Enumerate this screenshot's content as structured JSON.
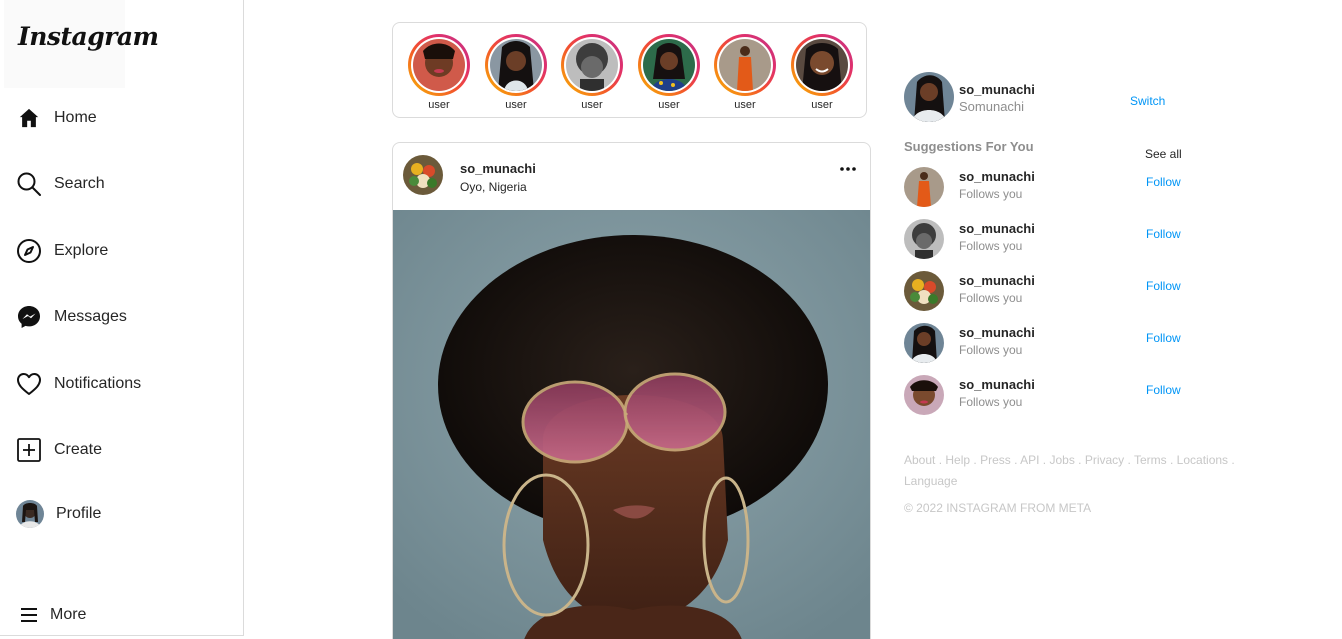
{
  "app": {
    "logo_text": "Instagram"
  },
  "nav": {
    "home": "Home",
    "search": "Search",
    "explore": "Explore",
    "messages": "Messages",
    "notifications": "Notifications",
    "create": "Create",
    "profile": "Profile",
    "more": "More"
  },
  "stories": [
    {
      "label": "user"
    },
    {
      "label": "user"
    },
    {
      "label": "user"
    },
    {
      "label": "user"
    },
    {
      "label": "user"
    },
    {
      "label": "user"
    }
  ],
  "post": {
    "username": "so_munachi",
    "location": "Oyo, Nigeria"
  },
  "account": {
    "username": "so_munachi",
    "full_name": "Somunachi",
    "switch_label": "Switch"
  },
  "suggestions": {
    "title": "Suggestions For You",
    "see_all": "See all",
    "items": [
      {
        "username": "so_munachi",
        "subtitle": "Follows you",
        "action": "Follow"
      },
      {
        "username": "so_munachi",
        "subtitle": "Follows you",
        "action": "Follow"
      },
      {
        "username": "so_munachi",
        "subtitle": "Follows you",
        "action": "Follow"
      },
      {
        "username": "so_munachi",
        "subtitle": "Follows you",
        "action": "Follow"
      },
      {
        "username": "so_munachi",
        "subtitle": "Follows you",
        "action": "Follow"
      }
    ]
  },
  "footer": {
    "links": [
      "About",
      "Help",
      "Press",
      "API",
      "Jobs",
      "Privacy",
      "Terms",
      "Locations",
      "Language"
    ],
    "copyright": "© 2022 INSTAGRAM FROM META"
  },
  "colors": {
    "link_blue": "#0095f6",
    "muted_gray": "#8e8e8e",
    "border": "#dbdbdb"
  }
}
